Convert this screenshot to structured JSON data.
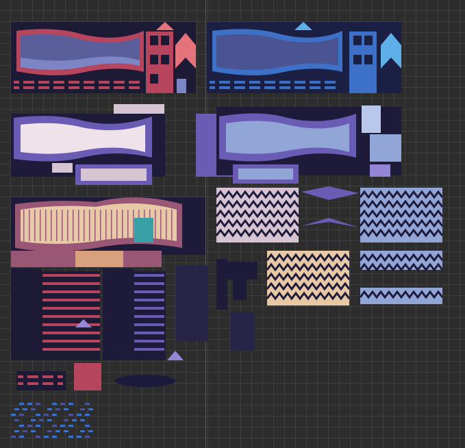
{
  "editor": {
    "grid_color": "#3f3f3f",
    "background_color": "#2d2d2d"
  },
  "palettes": {
    "red": {
      "dark": "#1d1a36",
      "mid": "#b8455e",
      "light": "#e5737b",
      "fill": "#5a5f9c",
      "fill_light": "#7c86c4"
    },
    "blue": {
      "dark": "#1b1f44",
      "mid": "#3c71c7",
      "light": "#5fb0e8",
      "fill": "#4b5492",
      "fill_light": "#6b7ac2"
    },
    "purple": {
      "dark": "#1e1a3a",
      "mid": "#6a5cb5",
      "light": "#9485d6",
      "fill": "#d7c4d3",
      "fill_light": "#f0e2ea"
    },
    "lavender": {
      "dark": "#1e1a3a",
      "mid": "#6a5cb5",
      "light": "#9485d6",
      "fill": "#91a6d6",
      "fill_light": "#b9c8ea"
    },
    "wood": {
      "dark": "#1e1a3a",
      "mid": "#9a5675",
      "light": "#d9a07e",
      "fill": "#e8c9a6",
      "fill_light": "#f7e2c3"
    }
  },
  "tiles": [
    {
      "name": "red-brick-window-frame",
      "palette": "red"
    },
    {
      "name": "blue-brick-window-frame",
      "palette": "blue"
    },
    {
      "name": "pink-wavy-window-frame",
      "palette": "purple"
    },
    {
      "name": "lavender-wavy-window-frame",
      "palette": "lavender"
    },
    {
      "name": "wooden-plank-wall",
      "palette": "wood"
    },
    {
      "name": "pink-zigzag-roof",
      "palette": "purple"
    },
    {
      "name": "lavender-zigzag-roof",
      "palette": "lavender"
    },
    {
      "name": "wood-zigzag-roof",
      "palette": "wood"
    },
    {
      "name": "brick-ledge-strips",
      "palette": "red"
    },
    {
      "name": "shadow-ellipse",
      "palette": "blue"
    }
  ]
}
